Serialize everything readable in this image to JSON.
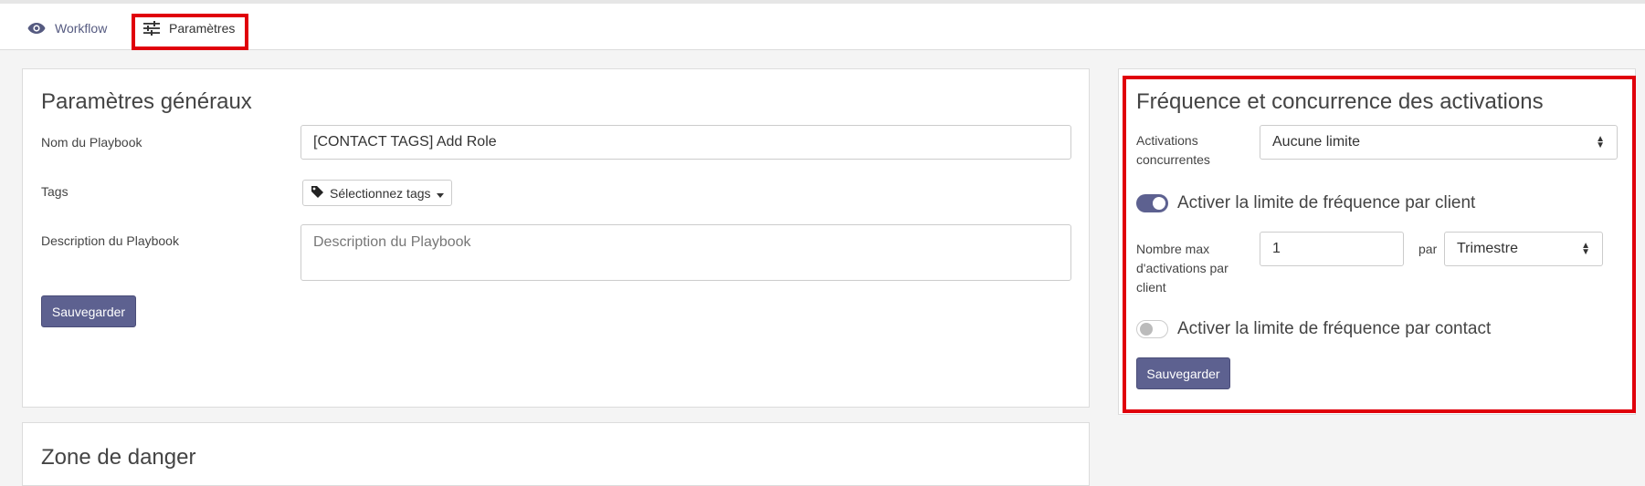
{
  "tabs": {
    "workflow": "Workflow",
    "params": "Paramètres"
  },
  "general": {
    "title": "Paramètres généraux",
    "name_label": "Nom du Playbook",
    "name_value": "[CONTACT TAGS] Add Role",
    "tags_label": "Tags",
    "tags_button": "Sélectionnez tags",
    "desc_label": "Description du Playbook",
    "desc_placeholder": "Description du Playbook",
    "save": "Sauvegarder"
  },
  "danger": {
    "title": "Zone de danger"
  },
  "frequency": {
    "title": "Fréquence et concurrence des activations",
    "concurrent_label_1": "Activations",
    "concurrent_label_2": "concurrentes",
    "concurrent_value": "Aucune limite",
    "client_toggle_label": "Activer la limite de fréquence par client",
    "client_toggle_on": true,
    "max_label_1": "Nombre max",
    "max_label_2": "d'activations par",
    "max_label_3": "client",
    "max_value": "1",
    "per_label": "par",
    "period_value": "Trimestre",
    "contact_toggle_label": "Activer la limite de fréquence par contact",
    "contact_toggle_on": false,
    "save": "Sauvegarder"
  },
  "colors": {
    "primary": "#5d6190",
    "highlight": "#e0000b"
  }
}
